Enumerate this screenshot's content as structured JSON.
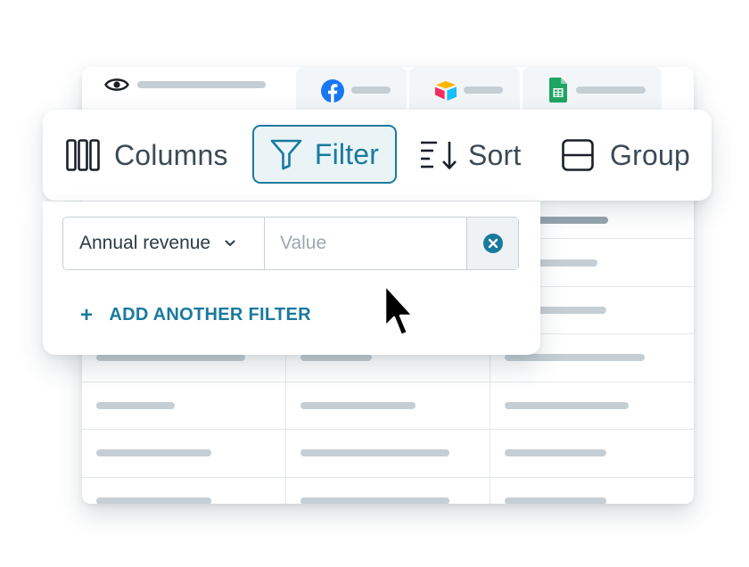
{
  "toolbar": {
    "columns_label": "Columns",
    "filter_label": "Filter",
    "sort_label": "Sort",
    "group_label": "Group"
  },
  "filter_panel": {
    "field_select_value": "Annual revenue",
    "value_placeholder": "Value",
    "add_filter_label": "ADD ANOTHER FILTER"
  },
  "tabs": [
    {
      "icon": "eye-icon"
    },
    {
      "icon": "facebook-icon"
    },
    {
      "icon": "airtable-icon"
    },
    {
      "icon": "google-sheets-icon"
    }
  ],
  "colors": {
    "accent": "#1a7a9e",
    "placeholder_bar": "#c5ced4",
    "header_bar": "#96a5ae",
    "facebook": "#1877f2",
    "sheets": "#1fa463"
  }
}
